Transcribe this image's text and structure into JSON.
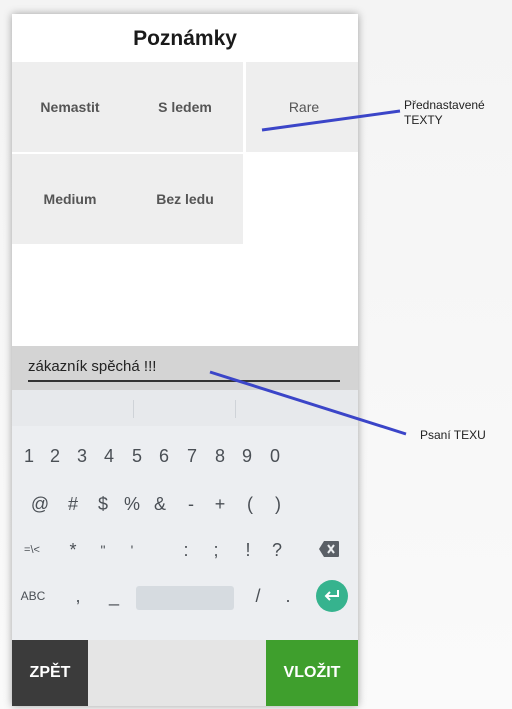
{
  "dialog": {
    "title": "Poznámky"
  },
  "presets": [
    "Nemastit",
    "S ledem",
    "Rare",
    "Medium",
    "Bez ledu"
  ],
  "note_input": {
    "value": "zákazník spěchá !!!"
  },
  "keyboard": {
    "row1": [
      "1",
      "2",
      "3",
      "4",
      "5",
      "6",
      "7",
      "8",
      "9",
      "0"
    ],
    "row2": [
      "@",
      "#",
      "$",
      "%",
      "&",
      "-",
      "+",
      "(",
      ")"
    ],
    "row3": [
      "=\\<",
      "*",
      "\"",
      "'",
      ":",
      ";",
      "!",
      "?"
    ],
    "row4_left": "ABC",
    "row4_keys": [
      ",",
      "_",
      "/",
      "."
    ],
    "icons": {
      "backspace": "backspace-icon",
      "enter": "enter-icon"
    }
  },
  "buttons": {
    "back": "ZPĚT",
    "insert": "VLOŽIT"
  },
  "annotations": {
    "presets_label_line1": "Přednastavené",
    "presets_label_line2": "TEXTY",
    "typing_label": "Psaní TEXU"
  },
  "colors": {
    "insert_button": "#3f9f2d",
    "back_button": "#3b3b3b",
    "enter_key": "#36b38e",
    "annotation_line": "#3b45c8"
  }
}
